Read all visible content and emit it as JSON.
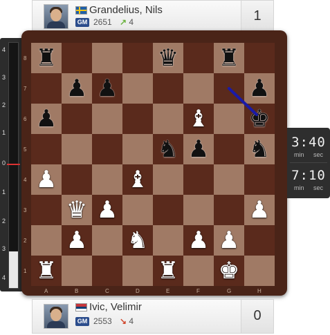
{
  "top_player": {
    "name": "Grandelius, Nils",
    "flag": "flag-sweden",
    "title": "GM",
    "rating": "2651",
    "rating_change": "4",
    "rating_trend": "up",
    "score": "1"
  },
  "bottom_player": {
    "name": "Ivic, Velimir",
    "flag": "flag-serbia",
    "title": "GM",
    "rating": "2553",
    "rating_change": "4",
    "rating_trend": "down",
    "score": "0"
  },
  "clocks": {
    "top": "3:40",
    "bottom": "7:10",
    "min_label": "min",
    "sec_label": "sec"
  },
  "eval_bar": {
    "ticks_top": [
      "4",
      "3",
      "2",
      "1"
    ],
    "zero": "0",
    "ticks_bottom": [
      "1",
      "2",
      "3",
      "4"
    ],
    "white_fraction": 0.15
  },
  "board": {
    "files": [
      "A",
      "B",
      "C",
      "D",
      "E",
      "F",
      "G",
      "H"
    ],
    "ranks": [
      "8",
      "7",
      "6",
      "5",
      "4",
      "3",
      "2",
      "1"
    ],
    "light_color": "#a07a65",
    "dark_color": "#5a2a1c",
    "pieces": [
      {
        "sq": "a8",
        "p": "r"
      },
      {
        "sq": "e8",
        "p": "q"
      },
      {
        "sq": "g8",
        "p": "r"
      },
      {
        "sq": "b7",
        "p": "p"
      },
      {
        "sq": "c7",
        "p": "p"
      },
      {
        "sq": "h7",
        "p": "p"
      },
      {
        "sq": "a6",
        "p": "p"
      },
      {
        "sq": "f6",
        "p": "B"
      },
      {
        "sq": "h6",
        "p": "k"
      },
      {
        "sq": "e5",
        "p": "n"
      },
      {
        "sq": "f5",
        "p": "p"
      },
      {
        "sq": "h5",
        "p": "n"
      },
      {
        "sq": "a4",
        "p": "P"
      },
      {
        "sq": "d4",
        "p": "B"
      },
      {
        "sq": "b3",
        "p": "Q"
      },
      {
        "sq": "c3",
        "p": "P"
      },
      {
        "sq": "h3",
        "p": "P"
      },
      {
        "sq": "b2",
        "p": "P"
      },
      {
        "sq": "d2",
        "p": "N"
      },
      {
        "sq": "f2",
        "p": "P"
      },
      {
        "sq": "g2",
        "p": "P"
      },
      {
        "sq": "a1",
        "p": "R"
      },
      {
        "sq": "e1",
        "p": "R"
      },
      {
        "sq": "g1",
        "p": "K"
      }
    ],
    "last_move": {
      "from": "g7",
      "to": "h6",
      "color": "#1a1aa8"
    }
  }
}
